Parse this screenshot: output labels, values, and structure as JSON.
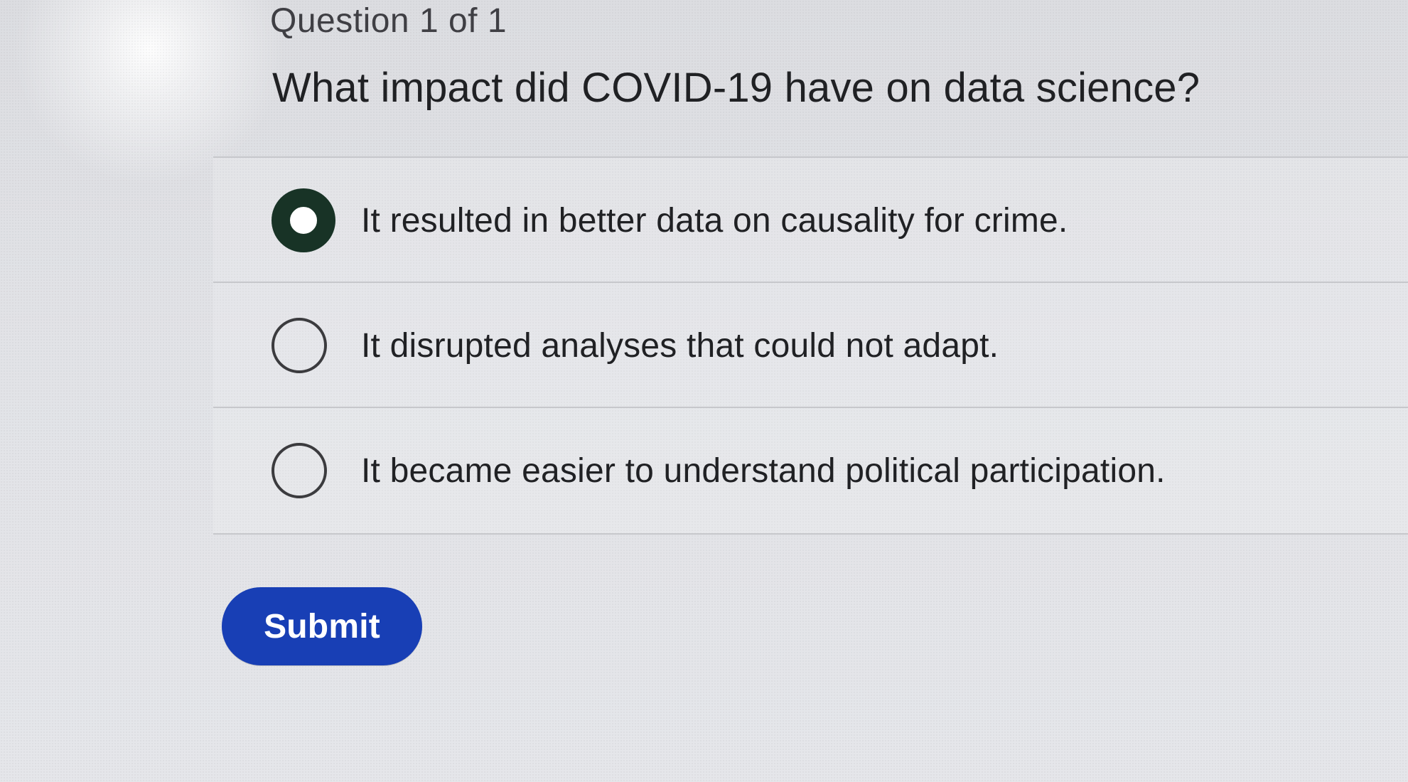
{
  "quiz": {
    "question_meta": "Question 1 of 1",
    "question_text": "What impact did COVID-19 have on data science?",
    "selected_option": 0,
    "options": [
      {
        "label": "It resulted in better data on causality for crime."
      },
      {
        "label": "It disrupted analyses that could not adapt."
      },
      {
        "label": "It became easier to understand political participation."
      }
    ],
    "submit_label": "Submit"
  },
  "colors": {
    "primary": "#183FB5",
    "selected_radio": "#183326"
  }
}
